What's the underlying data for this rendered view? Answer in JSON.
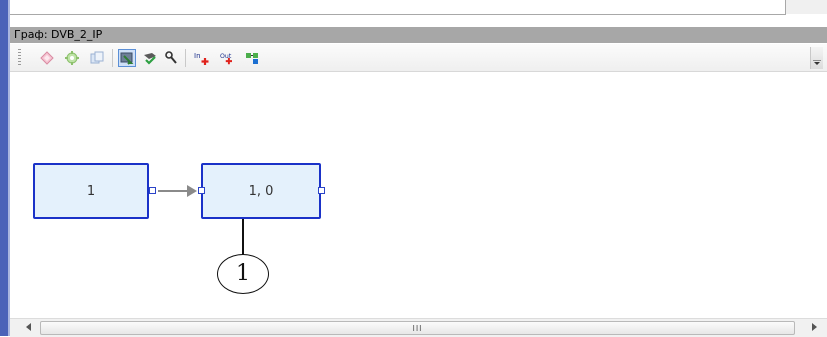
{
  "panel": {
    "title": "Граф: DVB_2_IP"
  },
  "toolbar": {
    "buttons": [
      {
        "icon": "diamond-pink-icon"
      },
      {
        "icon": "gear-green-icon"
      },
      {
        "icon": "copy-blue-icon"
      },
      {
        "icon": "select-tool-icon",
        "active": true
      },
      {
        "icon": "check-tool-icon"
      },
      {
        "icon": "wrench-icon"
      },
      {
        "icon": "add-input-icon",
        "label": "In"
      },
      {
        "icon": "add-output-icon",
        "label": "Out"
      },
      {
        "icon": "layout-green-icon"
      }
    ]
  },
  "graph": {
    "nodes": [
      {
        "id": "node-1",
        "label": "1"
      },
      {
        "id": "node-2",
        "label": "1, 0"
      }
    ],
    "edges": [
      {
        "from": "node-1",
        "to": "node-2"
      }
    ],
    "colors": {
      "node_border": "#1a32c8",
      "node_fill": "#e4f1fc",
      "edge": "#8a8a8a"
    }
  },
  "callout": {
    "number": "1"
  },
  "scrollbar": {
    "grip": "III"
  }
}
